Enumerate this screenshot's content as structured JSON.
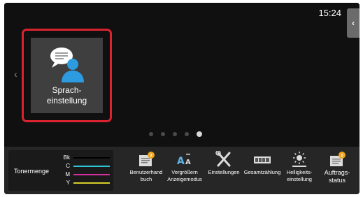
{
  "status": {
    "time": "15:24"
  },
  "nav": {
    "side_tab_glyph": "‹",
    "left_arrow_glyph": "‹"
  },
  "home": {
    "tile": {
      "label_line1": "Sprach-",
      "label_line2": "einstellung",
      "icon": "speech-person-icon",
      "highlight_color": "#d9232e"
    },
    "pages": {
      "count": 5,
      "active_index": 4
    }
  },
  "toner": {
    "title": "Tonermenge",
    "levels": [
      {
        "letter": "Bk",
        "color": "#000000"
      },
      {
        "letter": "C",
        "color": "#2ec4d6"
      },
      {
        "letter": "M",
        "color": "#d4309e"
      },
      {
        "letter": "Y",
        "color": "#d6cf2a"
      }
    ]
  },
  "functions": [
    {
      "line1": "Benutzerhand",
      "line2": "buch",
      "icon": "manual-icon"
    },
    {
      "line1": "Vergrößern",
      "line2": "Anzeigemodus",
      "icon": "text-enlarge-icon"
    },
    {
      "line1": "Einstellungen",
      "line2": "",
      "icon": "tools-icon"
    },
    {
      "line1": "Gesamtzählung",
      "line2": "",
      "icon": "counter-icon"
    },
    {
      "line1": "Helligkeits-",
      "line2": "einstellung",
      "icon": "brightness-icon"
    },
    {
      "line1": "Auftrags-",
      "line2": "status",
      "icon": "job-status-icon"
    }
  ]
}
